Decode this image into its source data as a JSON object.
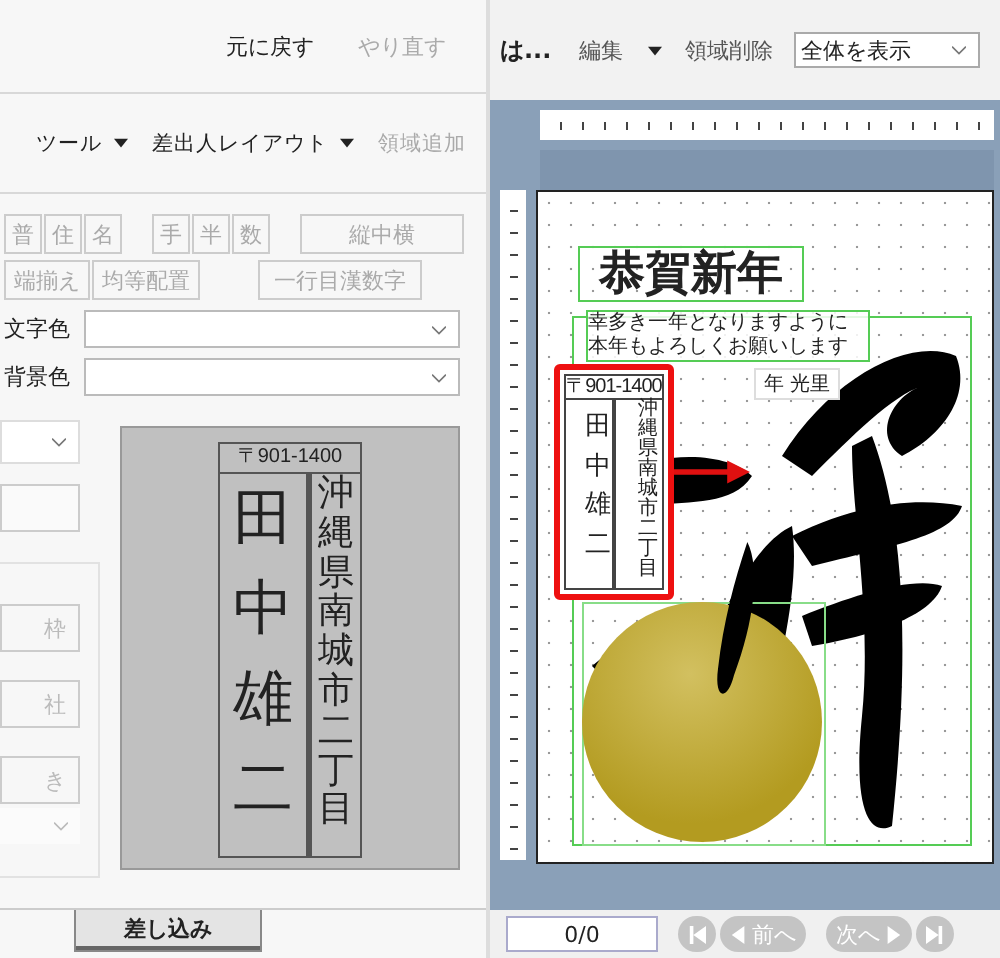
{
  "left_toolbar": {
    "items": [
      {
        "label": "元に戻す",
        "disabled": false
      },
      {
        "label": "やり直す",
        "disabled": true
      }
    ]
  },
  "left_toolbar_2": {
    "items": [
      {
        "label": "ツール",
        "kind": "menu",
        "disabled": false
      },
      {
        "label": "差出人レイアウト",
        "kind": "menu",
        "disabled": false
      },
      {
        "label": "領域追加",
        "kind": "action",
        "disabled": true
      }
    ]
  },
  "format_rows": [
    {
      "groups": [
        [
          {
            "label": "普",
            "kind": "char",
            "disabled": true
          },
          {
            "label": "住",
            "kind": "char",
            "disabled": true
          },
          {
            "label": "名",
            "kind": "char",
            "disabled": true
          }
        ],
        [
          {
            "label": "手",
            "kind": "char",
            "disabled": true
          },
          {
            "label": "半",
            "kind": "char",
            "disabled": true
          },
          {
            "label": "数",
            "kind": "char",
            "disabled": true
          }
        ],
        [
          {
            "label": "縦中横",
            "kind": "wide",
            "disabled": true
          }
        ]
      ]
    },
    {
      "groups": [
        [
          {
            "label": "端揃え",
            "kind": "text",
            "disabled": true
          },
          {
            "label": "均等配置",
            "kind": "text",
            "disabled": true
          }
        ],
        [
          {
            "label": "一行目漢数字",
            "kind": "wide",
            "disabled": true
          }
        ]
      ]
    }
  ],
  "color_fields": [
    {
      "label": "文字色"
    },
    {
      "label": "背景色"
    }
  ],
  "side_group": {
    "buttons": [
      {
        "label": "枠",
        "disabled": true
      },
      {
        "label": "社",
        "disabled": true
      },
      {
        "label": "き",
        "disabled": true
      }
    ]
  },
  "preview": {
    "postal": "〒901-1400",
    "name": "田中雄二",
    "address": "沖縄県南城市二丁目"
  },
  "tabs": [
    {
      "label": "差し込み",
      "selected": true
    }
  ],
  "right_toolbar": {
    "title": "は...",
    "items": [
      {
        "label": "編集",
        "kind": "menu"
      },
      {
        "label": "領域削除",
        "kind": "action"
      }
    ],
    "zoom_select": {
      "value": "全体を表示"
    }
  },
  "canvas": {
    "greeting": "恭賀新年",
    "message_lines": [
      "幸多き一年となりますように",
      "本年もよろしくお願いします"
    ],
    "sender": "年 光里",
    "address_label": {
      "postal": "〒901-1400",
      "name": "田中雄二",
      "address": "沖縄県南城市二丁目",
      "selected": true
    }
  },
  "bottom_bar": {
    "page_field": {
      "value": "0/0"
    },
    "nav_buttons": [
      {
        "kind": "first",
        "disabled": true
      },
      {
        "kind": "prev",
        "label": "前へ",
        "disabled": true
      },
      {
        "kind": "next",
        "label": "次へ",
        "disabled": true
      },
      {
        "kind": "last",
        "disabled": true
      }
    ]
  }
}
